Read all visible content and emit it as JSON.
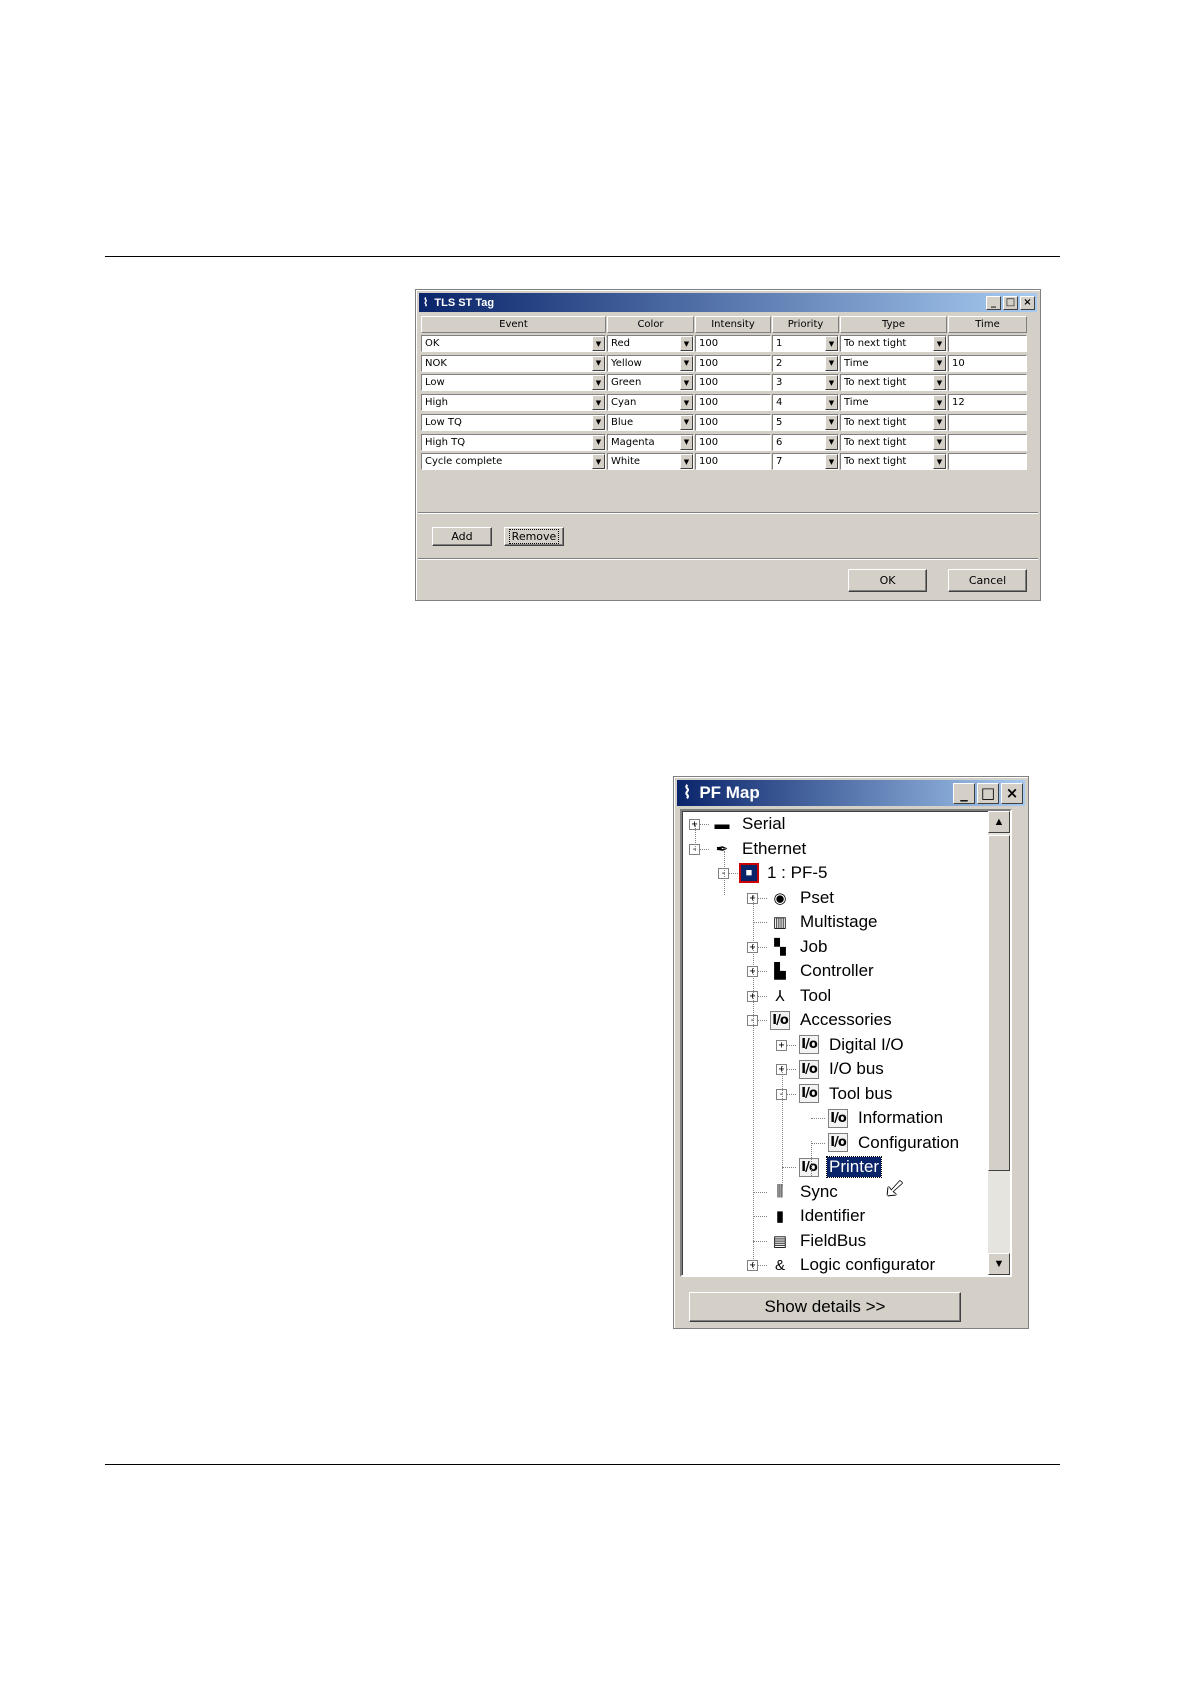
{
  "tls_dialog": {
    "title": "TLS ST Tag",
    "columns": [
      "Event",
      "Color",
      "Intensity",
      "Priority",
      "Type",
      "Time"
    ],
    "rows": [
      {
        "event": "OK",
        "color": "Red",
        "intensity": "100",
        "priority": "1",
        "type": "To next tight",
        "time": ""
      },
      {
        "event": "NOK",
        "color": "Yellow",
        "intensity": "100",
        "priority": "2",
        "type": "Time",
        "time": "10"
      },
      {
        "event": "Low",
        "color": "Green",
        "intensity": "100",
        "priority": "3",
        "type": "To next tight",
        "time": ""
      },
      {
        "event": "High",
        "color": "Cyan",
        "intensity": "100",
        "priority": "4",
        "type": "Time",
        "time": "12"
      },
      {
        "event": "Low TQ",
        "color": "Blue",
        "intensity": "100",
        "priority": "5",
        "type": "To next tight",
        "time": ""
      },
      {
        "event": "High TQ",
        "color": "Magenta",
        "intensity": "100",
        "priority": "6",
        "type": "To next tight",
        "time": ""
      },
      {
        "event": "Cycle complete",
        "color": "White",
        "intensity": "100",
        "priority": "7",
        "type": "To next tight",
        "time": ""
      }
    ],
    "add_label": "Add",
    "remove_label": "Remove",
    "ok_label": "OK",
    "cancel_label": "Cancel"
  },
  "pf_map": {
    "title": "PF Map",
    "tree": [
      {
        "label": "Serial",
        "icon": "serial-icon"
      },
      {
        "label": "Ethernet",
        "icon": "ethernet-icon"
      },
      {
        "label": "1 : PF-5",
        "icon": "controller-unit-icon"
      },
      {
        "label": "Pset",
        "icon": "pset-icon"
      },
      {
        "label": "Multistage",
        "icon": "multistage-icon"
      },
      {
        "label": "Job",
        "icon": "job-icon"
      },
      {
        "label": "Controller",
        "icon": "controller-icon"
      },
      {
        "label": "Tool",
        "icon": "tool-icon"
      },
      {
        "label": "Accessories",
        "icon": "io-icon"
      },
      {
        "label": "Digital I/O",
        "icon": "io-icon"
      },
      {
        "label": "I/O bus",
        "icon": "io-icon"
      },
      {
        "label": "Tool bus",
        "icon": "io-icon"
      },
      {
        "label": "Information",
        "icon": "io-icon"
      },
      {
        "label": "Configuration",
        "icon": "io-icon"
      },
      {
        "label": "Printer",
        "icon": "io-icon"
      },
      {
        "label": "Sync",
        "icon": "sync-icon"
      },
      {
        "label": "Identifier",
        "icon": "barcode-icon"
      },
      {
        "label": "FieldBus",
        "icon": "fieldbus-icon"
      },
      {
        "label": "Logic configurator",
        "icon": "logic-icon"
      }
    ],
    "selected": "Printer",
    "show_details_label": "Show details >>"
  }
}
